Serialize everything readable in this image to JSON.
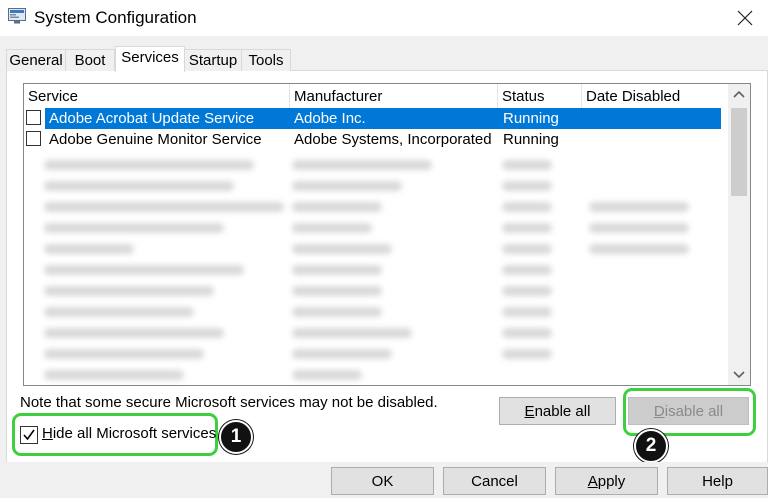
{
  "window": {
    "title": "System Configuration",
    "close_icon": "close-icon",
    "app_icon": "system-config-icon"
  },
  "tabs": [
    {
      "label": "General",
      "active": false
    },
    {
      "label": "Boot",
      "active": false
    },
    {
      "label": "Services",
      "active": true
    },
    {
      "label": "Startup",
      "active": false
    },
    {
      "label": "Tools",
      "active": false
    }
  ],
  "services": {
    "columns": [
      "Service",
      "Manufacturer",
      "Status",
      "Date Disabled"
    ],
    "rows": [
      {
        "service": "Adobe Acrobat Update Service",
        "manufacturer": "Adobe Inc.",
        "status": "Running",
        "date_disabled": "",
        "checked": false,
        "selected": true
      },
      {
        "service": "Adobe Genuine Monitor Service",
        "manufacturer": "Adobe Systems, Incorporated",
        "status": "Running",
        "date_disabled": "",
        "checked": false,
        "selected": false
      }
    ]
  },
  "note": "Note that some secure Microsoft services may not be disabled.",
  "buttons": {
    "enable_all": {
      "label": "Enable all",
      "mnemonic": "E"
    },
    "disable_all": {
      "label": "Disable all",
      "mnemonic": "D",
      "disabled": true
    },
    "ok": "OK",
    "cancel": "Cancel",
    "apply": {
      "label": "Apply",
      "mnemonic": "A"
    },
    "help": "Help"
  },
  "hide_ms": {
    "label": "Hide all Microsoft services",
    "mnemonic": "H",
    "checked": true
  },
  "annotations": {
    "step1": "1",
    "step2": "2",
    "highlight_color": "#3ecf3e"
  },
  "colors": {
    "selection": "#0078d7"
  }
}
